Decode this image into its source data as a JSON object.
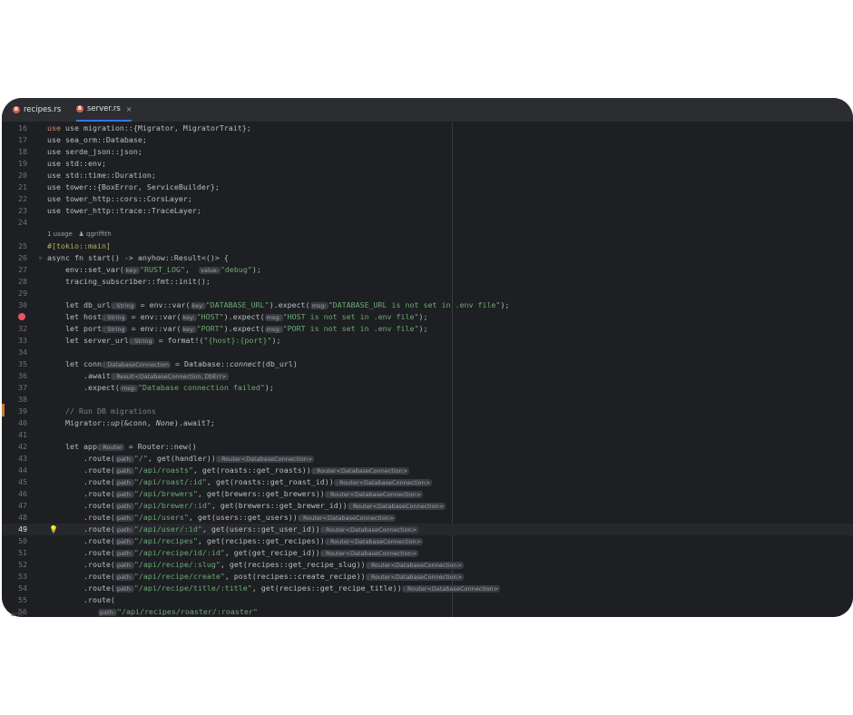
{
  "tabs": [
    {
      "label": "recipes.rs",
      "active": false
    },
    {
      "label": "server.rs",
      "active": true
    }
  ],
  "close_glyph": "×",
  "usage_hint": "1 usage",
  "author_hint": "qgriffith",
  "hints": {
    "key": "key:",
    "value": "value:",
    "msg": "msg:",
    "path": "path:",
    "type_string": ": String",
    "type_dbconn": ": DatabaseConnection",
    "type_result": ": Result<DatabaseConnection, DbErr>",
    "type_router": ": Router",
    "type_router_db": ": Router<DatabaseConnection>"
  },
  "line_numbers": [
    "16",
    "17",
    "18",
    "19",
    "20",
    "21",
    "22",
    "23",
    "24",
    "25",
    "26",
    "27",
    "28",
    "29",
    "30",
    "32",
    "32",
    "33",
    "34",
    "35",
    "36",
    "37",
    "38",
    "39",
    "40",
    "41",
    "42",
    "43",
    "44",
    "45",
    "46",
    "47",
    "48",
    "49",
    "50",
    "51",
    "52",
    "53",
    "54",
    "55",
    "56"
  ],
  "code": {
    "l16": "use migration::{Migrator, MigratorTrait};",
    "l17": "use sea_orm::Database;",
    "l18": "use serde_json::json;",
    "l19": "use std::env;",
    "l20": "use std::time::Duration;",
    "l21": "use tower::{BoxError, ServiceBuilder};",
    "l22": "use tower_http::cors::CorsLayer;",
    "l23": "use tower_http::trace::TraceLayer;",
    "l25": "#[tokio::main]",
    "l26": "async fn start() -> anyhow::Result<()> {",
    "l27a": "    env::set_var(",
    "l27b": "\"RUST_LOG\"",
    "l27c": "\"debug\"",
    "l28": "    tracing_subscriber::fmt::init();",
    "l30a": "    let db_url",
    "l30b": " = env::var(",
    "l30c": "\"DATABASE_URL\"",
    "l30d": ").expect(",
    "l30e": "\"DATABASE_URL is not set in .env file\"",
    "l32a": "    let host",
    "l32c": "\"HOST\"",
    "l32e": "\"HOST is not set in .env file\"",
    "l33a": "    let port",
    "l33c": "\"PORT\"",
    "l33e": "\"PORT is not set in .env file\"",
    "l34a": "    let server_url",
    "l34b": " = format!(",
    "l34c": "\"{host}:{port}\"",
    "l35a": "    let conn",
    "l35b": " = Database::",
    "l35c": "connect",
    "l35d": "(db_url)",
    "l36": "        .await",
    "l37a": "        .expect(",
    "l37b": "\"Database connection failed\"",
    "l39": "    // Run DB migrations",
    "l40a": "    Migrator::",
    "l40b": "up",
    "l40c": "(&conn, ",
    "l40d": "None",
    "l40e": ").await?;",
    "l42a": "    let app",
    "l42b": " = Router::",
    "l42c": "new",
    "l42d": "()",
    "route_prefix": "        .route(",
    "r43a": "\"/\"",
    "r43b": ", get(handler))",
    "r44a": "\"/api/roasts\"",
    "r44b": ", get(roasts::get_roasts))",
    "r45a": "\"/api/roast/:id\"",
    "r45b": ", get(roasts::get_roast_id))",
    "r46a": "\"/api/brewers\"",
    "r46b": ", get(brewers::get_brewers))",
    "r47a": "\"/api/brewer/:id\"",
    "r47b": ", get(brewers::get_brewer_id))",
    "r48a": "\"/api/users\"",
    "r48b": ", get(users::get_users))",
    "r49a": "\"/api/user/:id\"",
    "r49b": ", get(users::get_user_id))",
    "r50a": "\"/api/recipes\"",
    "r50b": ", get(recipes::get_recipes))",
    "r51a": "\"/api/recipe/id/:id\"",
    "r51b": ", get(get_recipe_id))",
    "r52a": "\"/api/recipe/:slug\"",
    "r52b": ", get(recipes::get_recipe_slug))",
    "r53a": "\"/api/recipe/create\"",
    "r53b": ", post(recipes::create_recipe))",
    "r54a": "\"/api/recipe/title/:title\"",
    "r54b": ", get(recipes::get_recipe_title))",
    "l55": "        .route(",
    "l56": "\"/api/recipes/roaster/:roaster\""
  },
  "bottom_fragment": "art0",
  "colors": {
    "window_bg": "#1e1f22",
    "keyword": "#cf8e6d",
    "string": "#6aab73",
    "function": "#56a8f5",
    "breakpoint": "#e55765",
    "accent": "#3574f0"
  }
}
